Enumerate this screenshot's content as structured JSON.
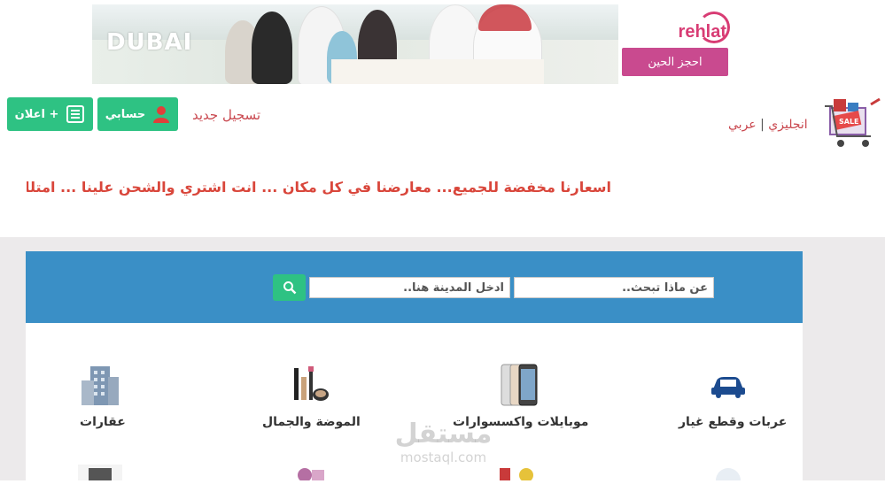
{
  "banner": {
    "dubai_logo": "DUBAI",
    "rehlat_logo": "rehlat",
    "book_button": "احجز الحين"
  },
  "header": {
    "ad_button": "اعلان +",
    "account_button": "حسابي",
    "register_link": "تسجيل جديد",
    "lang_arabic": "عربي",
    "lang_separator": "|",
    "lang_english": "انجليزي",
    "logo_badge": "SALE"
  },
  "ticker_text": "اسعارنا مخفضة للجميع... معارضنا في كل مكان ... انت اشتري والشحن علينا ... امتلك مح",
  "search": {
    "what_placeholder": "عن ماذا تبحث..",
    "city_placeholder": "ادخل المدينة هنا.."
  },
  "categories": [
    {
      "label": "عربات وقطع غيار",
      "icon": "car-icon"
    },
    {
      "label": "موبايلات واكسسوارات",
      "icon": "phone-icon"
    },
    {
      "label": "الموضة والجمال",
      "icon": "cosmetics-icon"
    },
    {
      "label": "عقارات",
      "icon": "building-icon"
    }
  ],
  "watermark": {
    "line1": "مستقل",
    "line2": "mostaql.com"
  },
  "colors": {
    "green": "#2ec283",
    "blue": "#3a8fc6",
    "red": "#d9463b",
    "grey_bg": "#eceaeb"
  }
}
